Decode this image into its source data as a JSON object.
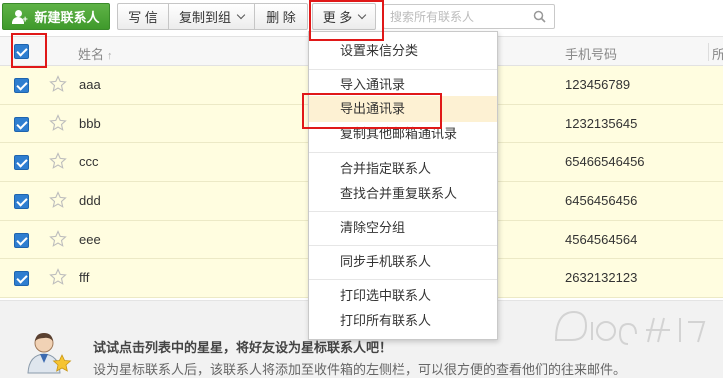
{
  "toolbar": {
    "new_contact_label": "新建联系人",
    "write_label": "写 信",
    "copy_to_group_label": "复制到组",
    "delete_label": "删 除",
    "more_label": "更 多"
  },
  "search": {
    "placeholder": "搜索所有联系人",
    "icon": "search-icon"
  },
  "table": {
    "header": {
      "name_label": "姓名",
      "sort_indicator": "↑",
      "phone_label": "手机号码",
      "extra_label": "所"
    },
    "rows": [
      {
        "name": "aaa",
        "phone": "123456789",
        "checked": true,
        "starred": false
      },
      {
        "name": "bbb",
        "phone": "1232135645",
        "checked": true,
        "starred": false
      },
      {
        "name": "ccc",
        "phone": "65466546456",
        "checked": true,
        "starred": false
      },
      {
        "name": "ddd",
        "phone": "6456456456",
        "checked": true,
        "starred": false
      },
      {
        "name": "eee",
        "phone": "4564564564",
        "checked": true,
        "starred": false
      },
      {
        "name": "fff",
        "phone": "2632132123",
        "checked": true,
        "starred": false
      }
    ]
  },
  "more_menu": {
    "items": [
      "设置来信分类",
      "导入通讯录",
      "导出通讯录",
      "复制其他邮箱通讯录",
      "合并指定联系人",
      "查找合并重复联系人",
      "清除空分组",
      "同步手机联系人",
      "打印选中联系人",
      "打印所有联系人"
    ],
    "highlighted": "导出通讯录"
  },
  "tip": {
    "title": "试试点击列表中的星星，将好友设为星标联系人吧！",
    "description": "设为星标联系人后，该联系人将添加至收件箱的左侧栏，可以很方便的查看他们的往来邮件。"
  },
  "colors": {
    "primary_green": "#4aa535",
    "row_highlight": "#fffde0",
    "checkbox_blue": "#2f7ed0",
    "annotation_red": "#e01818",
    "menu_hover": "#fdf1d3"
  }
}
